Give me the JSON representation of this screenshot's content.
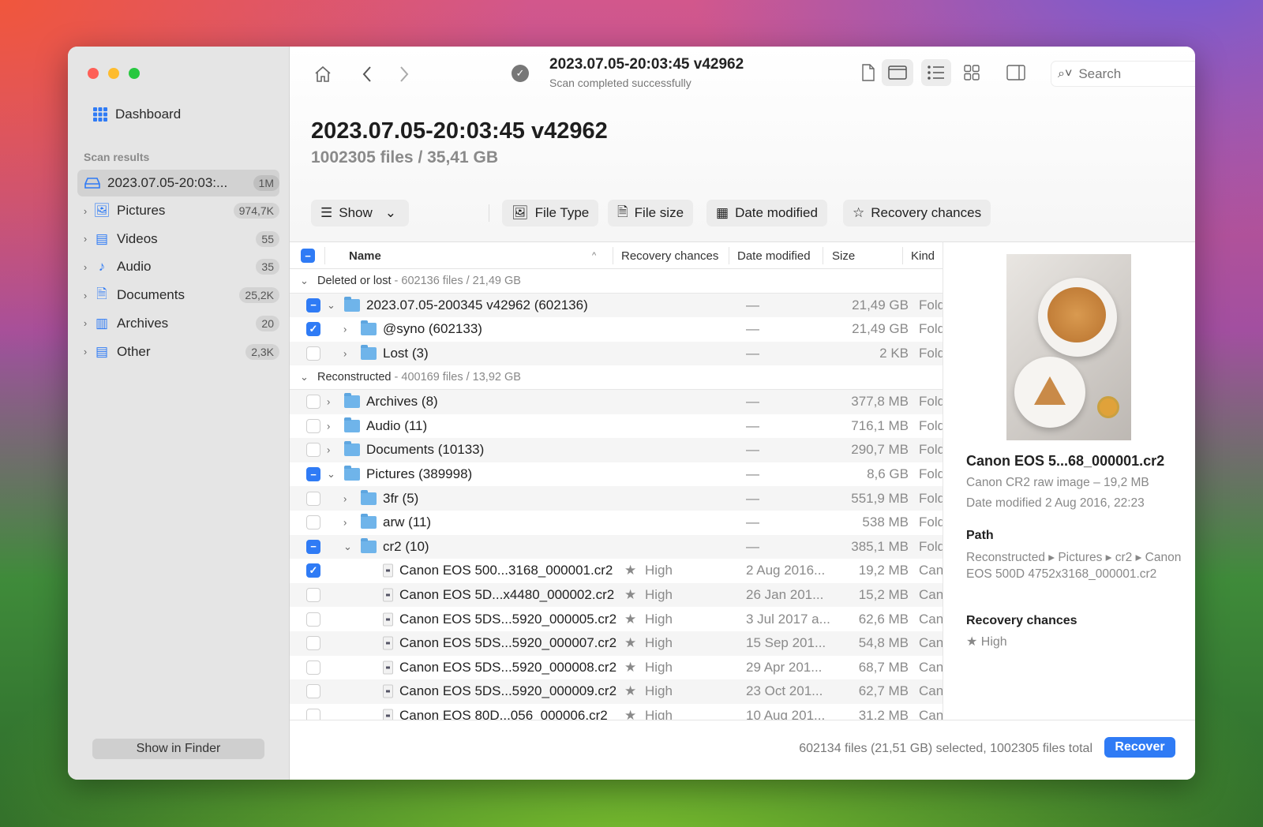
{
  "window": {
    "traffic_lights": {
      "close": "#fe5f57",
      "minimize": "#febc2e",
      "zoom": "#28c840"
    }
  },
  "sidebar": {
    "dashboard_label": "Dashboard",
    "section_title": "Scan results",
    "scan_item": {
      "label": "2023.07.05-20:03:...",
      "count": "1M"
    },
    "items": [
      {
        "label": "Pictures",
        "count": "974,7K",
        "icon": "photo-icon"
      },
      {
        "label": "Videos",
        "count": "55",
        "icon": "film-icon"
      },
      {
        "label": "Audio",
        "count": "35",
        "icon": "music-note-icon"
      },
      {
        "label": "Documents",
        "count": "25,2K",
        "icon": "document-icon"
      },
      {
        "label": "Archives",
        "count": "20",
        "icon": "archive-icon"
      },
      {
        "label": "Other",
        "count": "2,3K",
        "icon": "other-file-icon"
      }
    ],
    "show_in_finder": "Show in Finder"
  },
  "toolbar": {
    "title": "2023.07.05-20:03:45 v42962",
    "subtitle": "Scan completed successfully",
    "search_placeholder": "Search"
  },
  "header": {
    "title": "2023.07.05-20:03:45 v42962",
    "subtitle": "1002305 files / 35,41 GB"
  },
  "filters": {
    "show": "Show",
    "file_type": "File Type",
    "file_size": "File size",
    "date_modified": "Date modified",
    "recovery_chances": "Recovery chances"
  },
  "table": {
    "columns": {
      "name": "Name",
      "recovery": "Recovery chances",
      "date": "Date modified",
      "size": "Size",
      "kind": "Kind"
    },
    "rows": [
      {
        "type": "group",
        "label": "Deleted or lost",
        "meta": " - 602136 files / 21,49 GB"
      },
      {
        "level": 1,
        "check": "mixed",
        "expand": "open",
        "kind_icon": "folder",
        "name": "2023.07.05-200345 v42962 (602136)",
        "date": "—",
        "size": "21,49 GB",
        "kind": "Folder"
      },
      {
        "level": 2,
        "check": "on",
        "expand": "closed",
        "kind_icon": "folder",
        "name": "@syno (602133)",
        "date": "—",
        "size": "21,49 GB",
        "kind": "Folder"
      },
      {
        "level": 2,
        "check": "off",
        "expand": "closed",
        "kind_icon": "folder",
        "name": "Lost (3)",
        "date": "—",
        "size": "2 KB",
        "kind": "Folder"
      },
      {
        "type": "group",
        "label": "Reconstructed",
        "meta": " - 400169 files / 13,92 GB"
      },
      {
        "level": 1,
        "check": "off",
        "expand": "closed",
        "kind_icon": "folder",
        "name": "Archives (8)",
        "date": "—",
        "size": "377,8 MB",
        "kind": "Folder"
      },
      {
        "level": 1,
        "check": "off",
        "expand": "closed",
        "kind_icon": "folder",
        "name": "Audio (11)",
        "date": "—",
        "size": "716,1 MB",
        "kind": "Folder"
      },
      {
        "level": 1,
        "check": "off",
        "expand": "closed",
        "kind_icon": "folder",
        "name": "Documents (10133)",
        "date": "—",
        "size": "290,7 MB",
        "kind": "Folder"
      },
      {
        "level": 1,
        "check": "mixed",
        "expand": "open",
        "kind_icon": "folder",
        "name": "Pictures (389998)",
        "date": "—",
        "size": "8,6 GB",
        "kind": "Folder"
      },
      {
        "level": 2,
        "check": "off",
        "expand": "closed",
        "kind_icon": "folder",
        "name": "3fr (5)",
        "date": "—",
        "size": "551,9 MB",
        "kind": "Folder"
      },
      {
        "level": 2,
        "check": "off",
        "expand": "closed",
        "kind_icon": "folder",
        "name": "arw (11)",
        "date": "—",
        "size": "538 MB",
        "kind": "Folder"
      },
      {
        "level": 2,
        "check": "mixed",
        "expand": "open",
        "kind_icon": "folder",
        "name": "cr2 (10)",
        "date": "—",
        "size": "385,1 MB",
        "kind": "Folder"
      },
      {
        "level": 3,
        "check": "on",
        "kind_icon": "file",
        "name": "Canon EOS 500...3168_000001.cr2",
        "recovery": "High",
        "date": "2 Aug 2016...",
        "size": "19,2 MB",
        "kind": "Canon"
      },
      {
        "level": 3,
        "check": "off",
        "kind_icon": "file",
        "name": "Canon EOS 5D...x4480_000002.cr2",
        "recovery": "High",
        "date": "26 Jan 201...",
        "size": "15,2 MB",
        "kind": "Canon"
      },
      {
        "level": 3,
        "check": "off",
        "kind_icon": "file",
        "name": "Canon EOS 5DS...5920_000005.cr2",
        "recovery": "High",
        "date": "3 Jul 2017 a...",
        "size": "62,6 MB",
        "kind": "Canon"
      },
      {
        "level": 3,
        "check": "off",
        "kind_icon": "file",
        "name": "Canon EOS 5DS...5920_000007.cr2",
        "recovery": "High",
        "date": "15 Sep 201...",
        "size": "54,8 MB",
        "kind": "Canon"
      },
      {
        "level": 3,
        "check": "off",
        "kind_icon": "file",
        "name": "Canon EOS 5DS...5920_000008.cr2",
        "recovery": "High",
        "date": "29 Apr 201...",
        "size": "68,7 MB",
        "kind": "Canon"
      },
      {
        "level": 3,
        "check": "off",
        "kind_icon": "file",
        "name": "Canon EOS 5DS...5920_000009.cr2",
        "recovery": "High",
        "date": "23 Oct 201...",
        "size": "62,7 MB",
        "kind": "Canon"
      },
      {
        "level": 3,
        "check": "off",
        "kind_icon": "file",
        "name": "Canon EOS 80D...056_000006.cr2",
        "recovery": "High",
        "date": "10 Aug 201...",
        "size": "31,2 MB",
        "kind": "Canon"
      }
    ]
  },
  "details": {
    "file_name": "Canon EOS 5...68_000001.cr2",
    "file_info": "Canon CR2 raw image – 19,2 MB",
    "date_label": "Date modified",
    "date_value": "2 Aug 2016, 22:23",
    "path_title": "Path",
    "path_value": "Reconstructed ▸ Pictures ▸ cr2 ▸ Canon EOS 500D 4752x3168_000001.cr2",
    "recovery_title": "Recovery chances",
    "recovery_value": "High"
  },
  "footer": {
    "status": "602134 files (21,51 GB) selected, 1002305 files total",
    "recover_label": "Recover"
  },
  "colors": {
    "accent": "#2f7bf5",
    "folder": "#6fb4ea"
  }
}
